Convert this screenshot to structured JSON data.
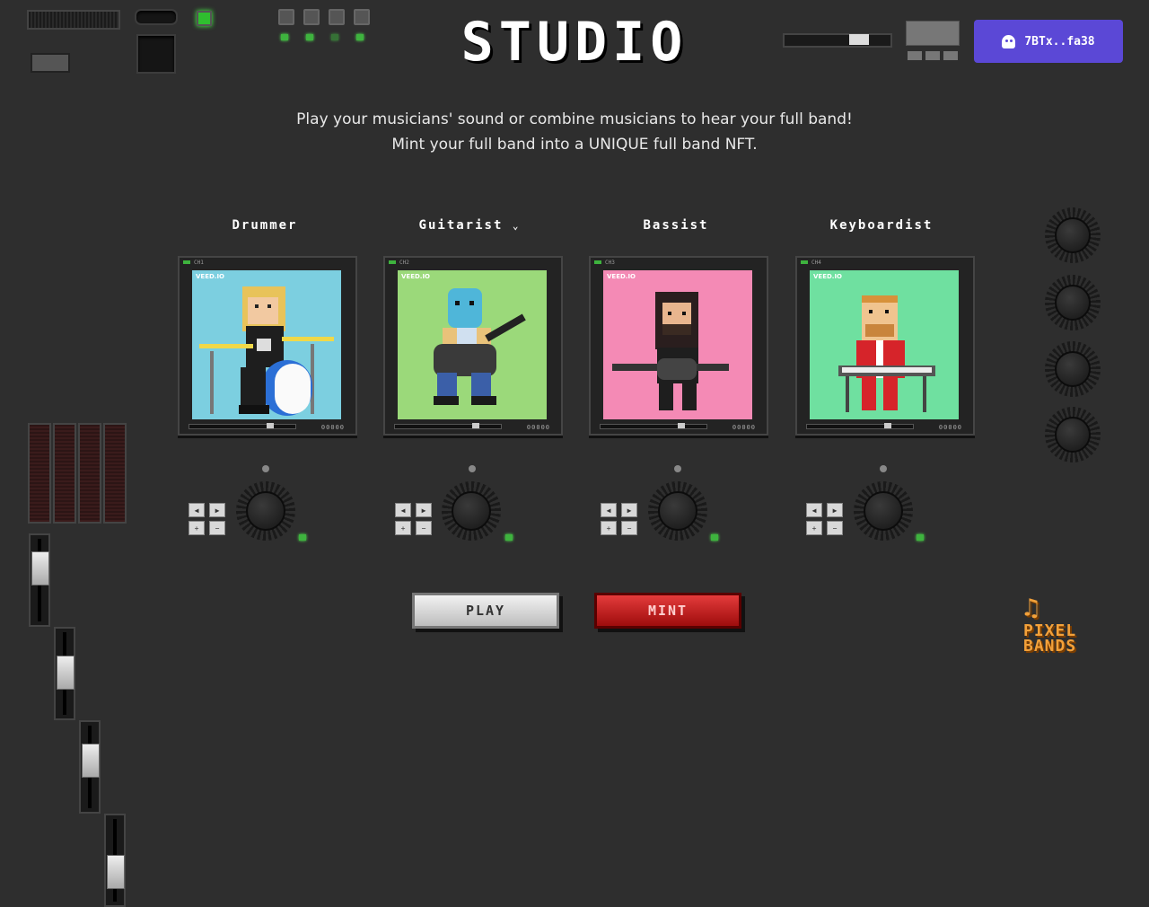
{
  "header": {
    "title": "STUDIO"
  },
  "wallet": {
    "address": "7BTx..fa38",
    "icon": "ghost-icon"
  },
  "intro": {
    "line1": "Play your musicians' sound or combine musicians to hear your full band!",
    "line2": "Mint your full band into a UNIQUE full band NFT."
  },
  "channels": [
    {
      "role": "Drummer",
      "ch": "CH1",
      "watermark": "VEED.IO",
      "counter": "00000",
      "bg": "#7ccfe0"
    },
    {
      "role": "Guitarist",
      "has_dropdown": true,
      "ch": "CH2",
      "watermark": "VEED.IO",
      "counter": "00000",
      "bg": "#9bd97a"
    },
    {
      "role": "Bassist",
      "ch": "CH3",
      "watermark": "VEED.IO",
      "counter": "00000",
      "bg": "#f48ab5"
    },
    {
      "role": "Keyboardist",
      "ch": "CH4",
      "watermark": "VEED.IO",
      "counter": "00000",
      "bg": "#6fe0a0"
    }
  ],
  "actions": {
    "play": "PLAY",
    "mint": "MINT"
  },
  "logo": {
    "line1": "PIXEL",
    "line2": "BANDS"
  },
  "colors": {
    "background": "#2e2e2e",
    "wallet": "#5b48d6",
    "mint": "#c81818",
    "led": "#3eb33e"
  }
}
